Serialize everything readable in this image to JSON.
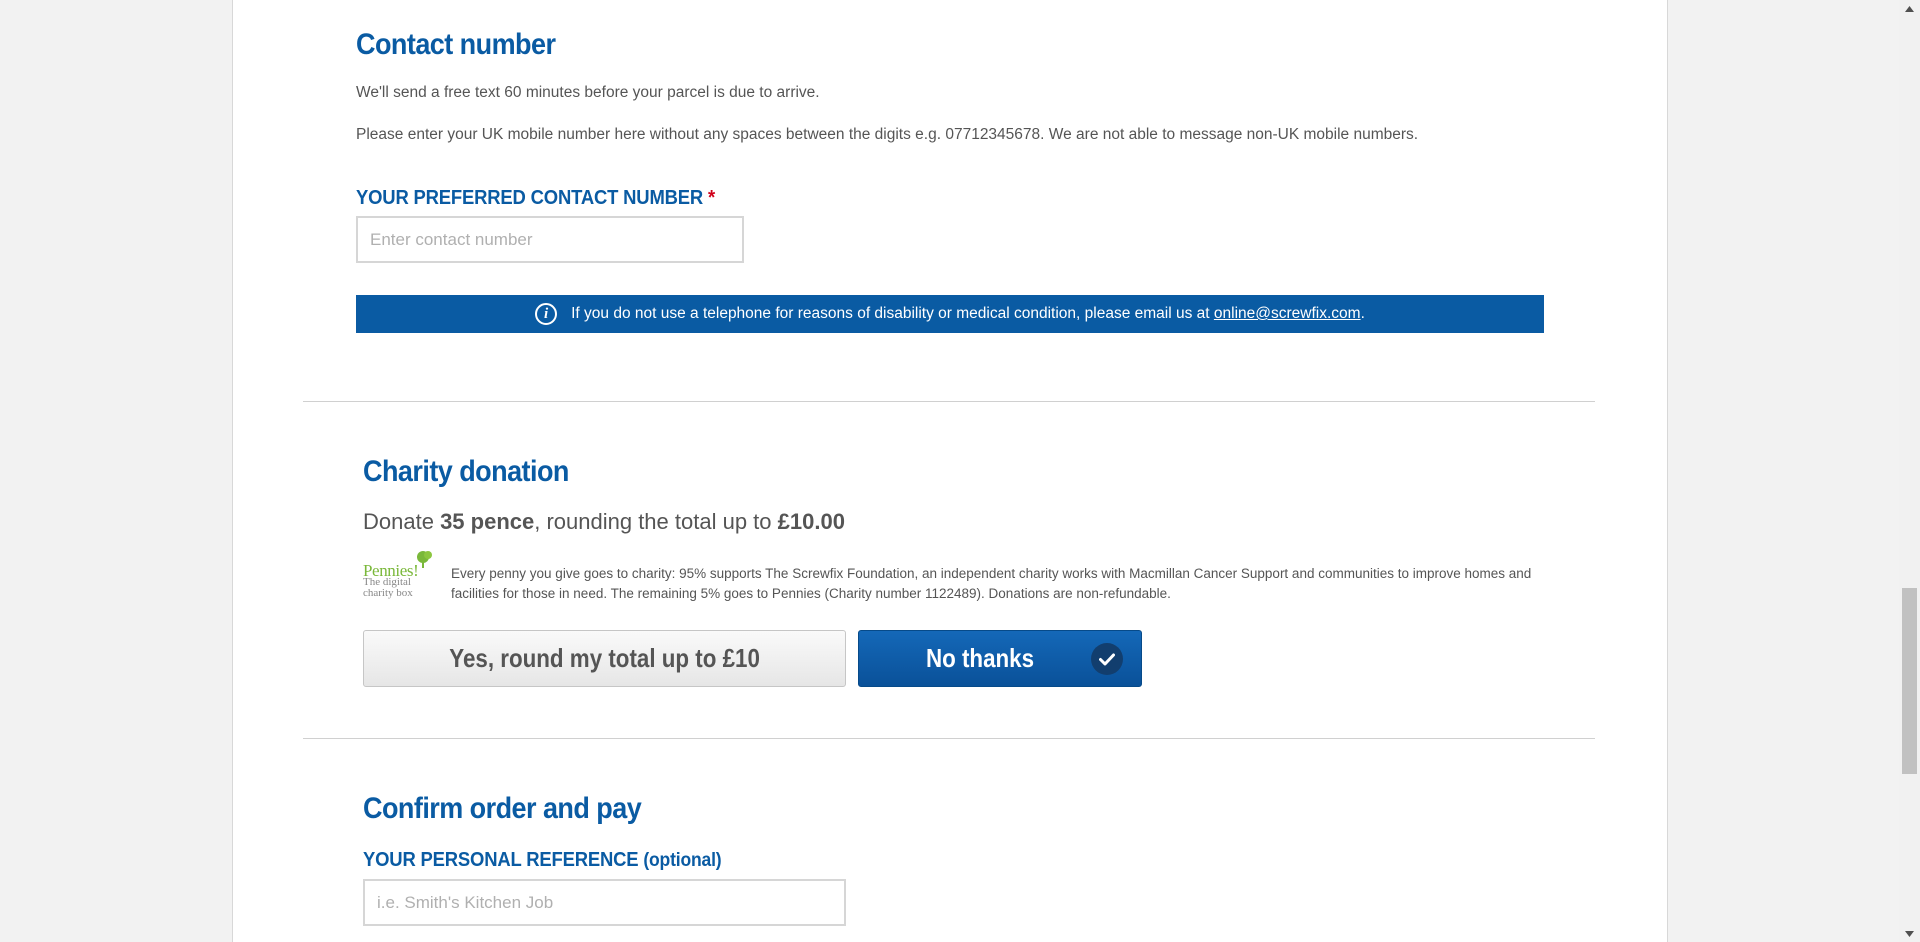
{
  "contact": {
    "heading": "Contact number",
    "intro": "We'll send a free text 60 minutes before your parcel is due to arrive.",
    "instructions": "Please enter your UK mobile number here without any spaces between the digits e.g. 07712345678. We are not able to message non-UK mobile numbers.",
    "field_label": "YOUR PREFERRED CONTACT NUMBER",
    "required_mark": "*",
    "field_placeholder": "Enter contact number",
    "field_value": "",
    "info_text": "If you do not use a telephone for reasons of disability or medical condition, please email us at",
    "info_email": "online@screwfix.com",
    "info_suffix": "."
  },
  "charity": {
    "heading": "Charity donation",
    "donate_prefix": "Donate ",
    "donate_amount": "35 pence",
    "donate_middle": ", rounding the total up to ",
    "donate_total": "£10.00",
    "logo_brand": "Pennies!",
    "logo_tagline_1": "The digital",
    "logo_tagline_2": "charity box",
    "description": "Every penny you give goes to charity: 95% supports The Screwfix Foundation, an independent charity works with Macmillan Cancer Support and communities to improve homes and facilities for those in need. The remaining 5% goes to Pennies (Charity number 1122489). Donations are non-refundable.",
    "yes_button": "Yes, round my total up to £10",
    "no_button": "No thanks",
    "selected": "no"
  },
  "confirm": {
    "heading": "Confirm order and pay",
    "ref_label": "YOUR PERSONAL REFERENCE",
    "ref_optional": "(optional)",
    "ref_placeholder": "i.e. Smith's Kitchen Job",
    "ref_value": ""
  },
  "colors": {
    "brand_blue": "#0a5ba3",
    "required_red": "#d0021b",
    "pennies_green": "#7ab83a"
  },
  "scrollbar": {
    "thumb_position_fraction": 0.68
  }
}
